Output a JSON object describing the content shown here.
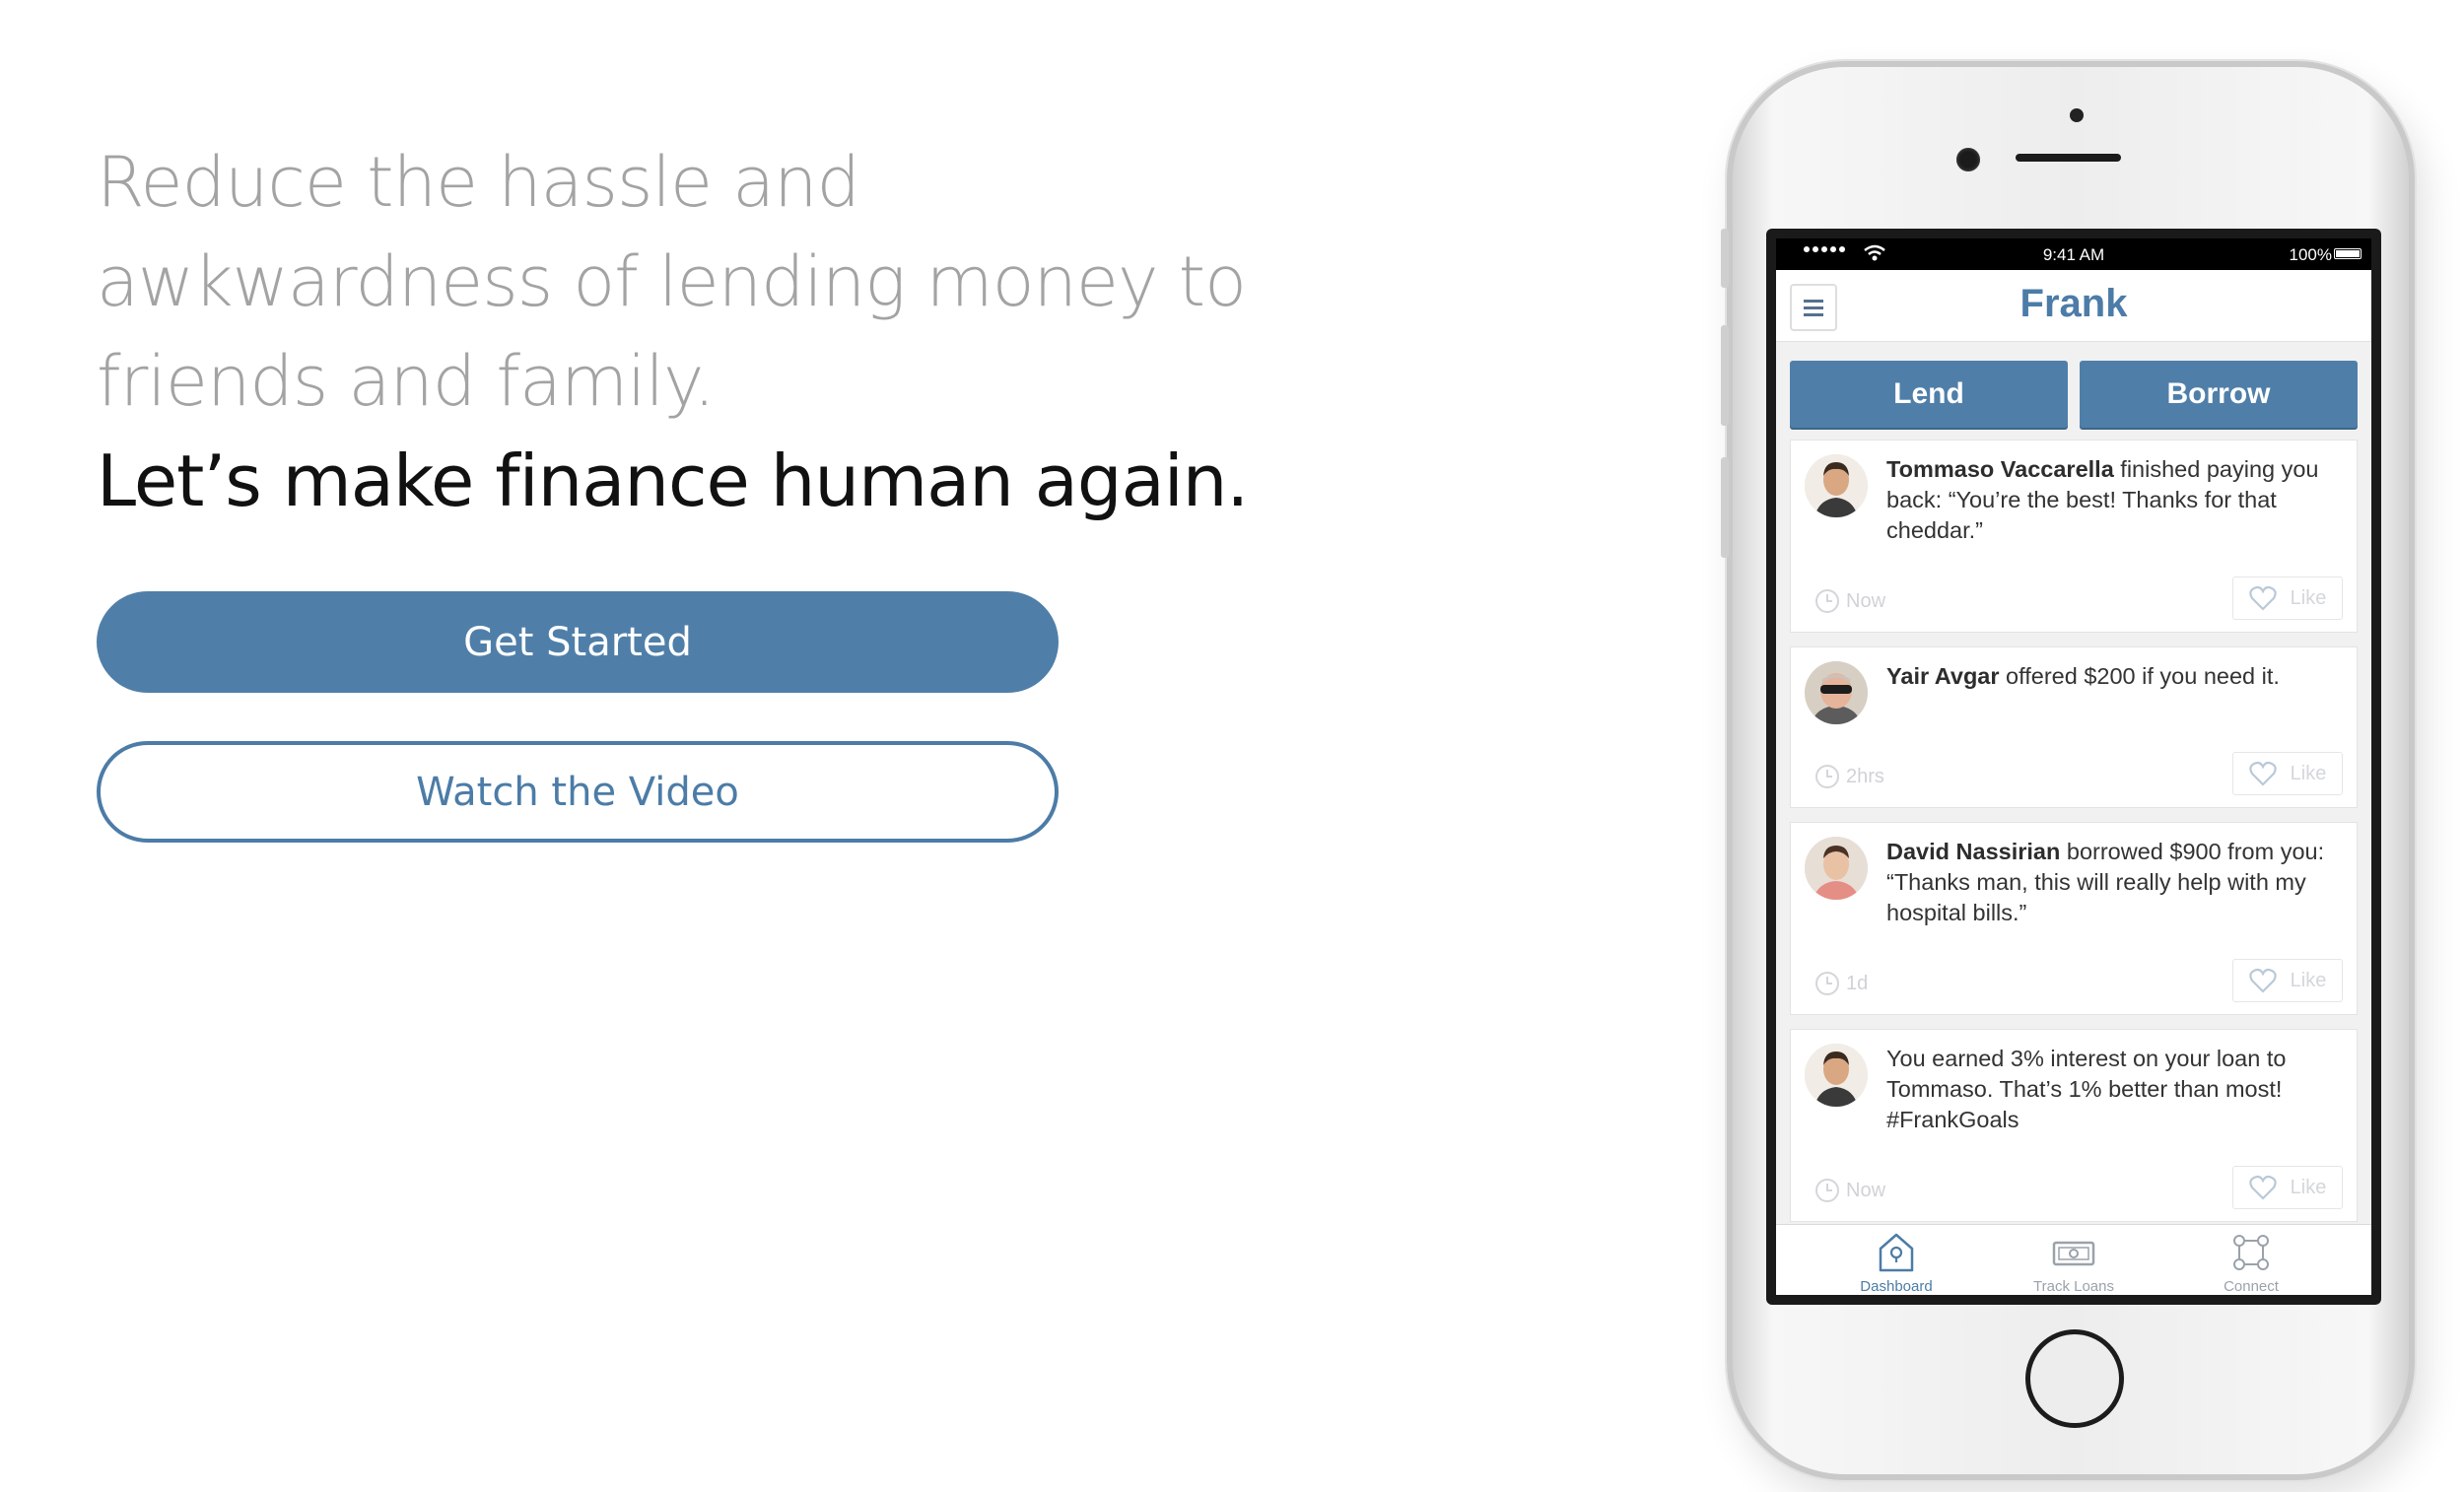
{
  "hero": {
    "tagline": "Reduce the hassle and awkwardness of lending money to friends and family.",
    "headline": "Let’s make finance human again.",
    "primary_cta": "Get Started",
    "secondary_cta": "Watch the Video"
  },
  "phone": {
    "status_bar": {
      "time": "9:41 AM",
      "battery": "100%"
    },
    "app_title": "Frank",
    "tabs": [
      {
        "label": "Lend"
      },
      {
        "label": "Borrow"
      }
    ],
    "feed": [
      {
        "name": "Tommaso Vaccarella",
        "message": " finished paying you back: “You’re the best! Thanks for that cheddar.”",
        "time": "Now",
        "like": "Like"
      },
      {
        "name": "Yair Avgar",
        "message": " offered $200 if you need it.",
        "time": "2hrs",
        "like": "Like"
      },
      {
        "name": "David Nassirian",
        "message": " borrowed $900 from you: “Thanks man, this will really help with my hospital bills.”",
        "time": "1d",
        "like": "Like"
      },
      {
        "name": "",
        "message": "You earned 3% interest on your loan to Tommaso.  That’s 1% better than most! #FrankGoals",
        "time": "Now",
        "like": "Like"
      }
    ],
    "tabbar": [
      {
        "label": "Dashboard",
        "icon": "home-icon",
        "active": true
      },
      {
        "label": "Track Loans",
        "icon": "cash-icon",
        "active": false
      },
      {
        "label": "Connect",
        "icon": "connect-icon",
        "active": false
      }
    ]
  },
  "colors": {
    "brand": "#4f7fa9",
    "tagline": "#a3a3a3",
    "headline": "#111111"
  }
}
